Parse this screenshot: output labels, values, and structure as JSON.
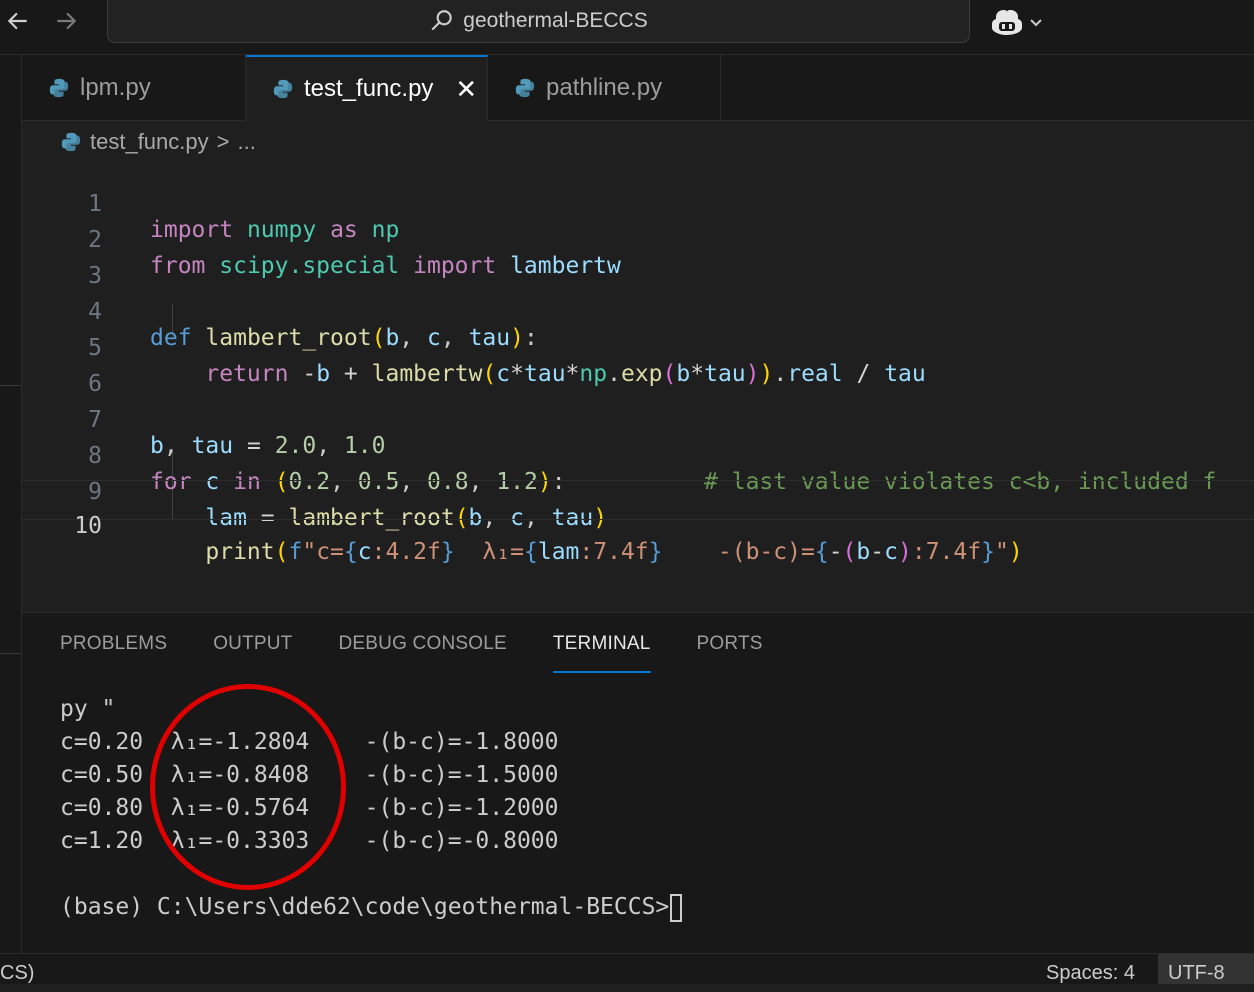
{
  "title_bar": {
    "back_icon": "arrow-left-icon",
    "forward_icon": "arrow-right-icon",
    "search_icon": "search-icon",
    "search_label": "geothermal-BECCS",
    "copilot_icon": "copilot-icon",
    "copilot_menu_icon": "chevron-down-icon"
  },
  "tabs": [
    {
      "label": "lpm.py",
      "active": false,
      "icon": "python-file-icon"
    },
    {
      "label": "test_func.py",
      "active": true,
      "icon": "python-file-icon",
      "close_label": "✕"
    },
    {
      "label": "pathline.py",
      "active": false,
      "icon": "python-file-icon"
    }
  ],
  "breadcrumb": {
    "file": "test_func.py",
    "separator": ">",
    "ellipsis": "..."
  },
  "editor": {
    "current_line": 10,
    "line_numbers": [
      "1",
      "2",
      "3",
      "4",
      "5",
      "6",
      "7",
      "8",
      "9",
      "10"
    ],
    "lines": [
      "import numpy as np",
      "from scipy.special import lambertw",
      "",
      "def lambert_root(b, c, tau):",
      "    return -b + lambertw(c*tau*np.exp(b*tau)).real / tau",
      "",
      "b, tau = 2.0, 1.0",
      "for c in (0.2, 0.5, 0.8, 1.2):          # last value violates c<b, included f",
      "    lam = lambert_root(b, c, tau)",
      "    print(f\"c={c:4.2f}  λ₁={lam:7.4f}    -(b-c)={-(b-c):7.4f}\")"
    ]
  },
  "panel": {
    "tabs": [
      "PROBLEMS",
      "OUTPUT",
      "DEBUG CONSOLE",
      "TERMINAL",
      "PORTS"
    ],
    "active_tab": "TERMINAL",
    "terminal_lines": [
      "py \"",
      "c=0.20  λ₁=-1.2804    -(b-c)=-1.8000",
      "c=0.50  λ₁=-0.8408    -(b-c)=-1.5000",
      "c=0.80  λ₁=-0.5764    -(b-c)=-1.2000",
      "c=1.20  λ₁=-0.3303    -(b-c)=-0.8000",
      "",
      "(base) C:\\Users\\dde62\\code\\geothermal-BECCS>"
    ],
    "annotation_color": "#e00000"
  },
  "status_bar": {
    "left_fragment": "CS)",
    "spaces": "Spaces: 4",
    "encoding": "UTF-8"
  },
  "colors": {
    "background": "#1f1f1f",
    "chrome": "#181818",
    "accent": "#0078d4"
  }
}
